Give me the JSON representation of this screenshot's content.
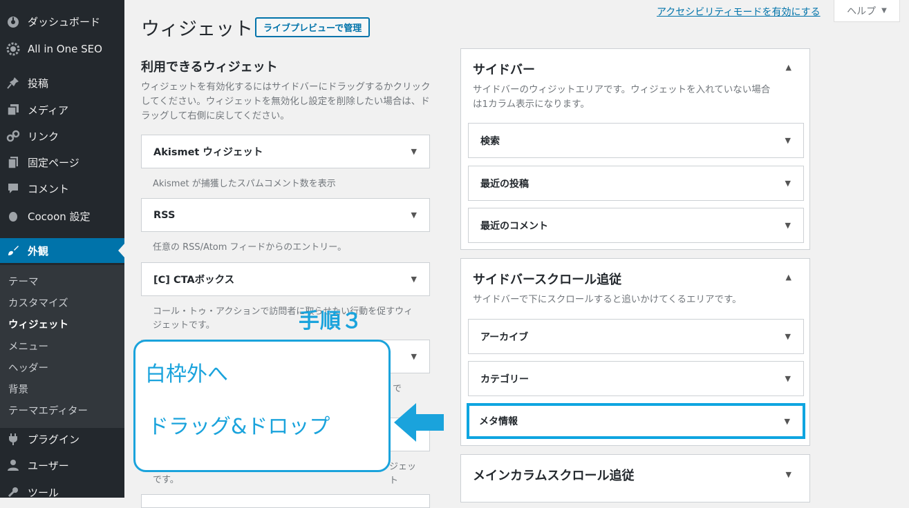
{
  "sidebar": {
    "items": [
      {
        "label": "ダッシュボード",
        "icon": "dashboard-icon"
      },
      {
        "label": "All in One SEO",
        "icon": "gear-icon"
      },
      {
        "label": "投稿",
        "icon": "pin-icon"
      },
      {
        "label": "メディア",
        "icon": "media-icon"
      },
      {
        "label": "リンク",
        "icon": "link-icon"
      },
      {
        "label": "固定ページ",
        "icon": "page-icon"
      },
      {
        "label": "コメント",
        "icon": "comment-icon"
      },
      {
        "label": "Cocoon 設定",
        "icon": "circle-icon"
      },
      {
        "label": "外観",
        "icon": "brush-icon"
      },
      {
        "label": "プラグイン",
        "icon": "plugin-icon"
      },
      {
        "label": "ユーザー",
        "icon": "user-icon"
      },
      {
        "label": "ツール",
        "icon": "wrench-icon"
      }
    ],
    "submenu": [
      "テーマ",
      "カスタマイズ",
      "ウィジェット",
      "メニュー",
      "ヘッダー",
      "背景",
      "テーマエディター"
    ]
  },
  "header": {
    "a11y_link": "アクセシビリティモードを有効にする",
    "help": "ヘルプ",
    "title": "ウィジェット",
    "live_preview": "ライブプレビューで管理"
  },
  "available": {
    "title": "利用できるウィジェット",
    "desc": "ウィジェットを有効化するにはサイドバーにドラッグするかクリックしてください。ウィジェットを無効化し設定を削除したい場合は、ドラッグして右側に戻してください。",
    "widgets": [
      {
        "name": "Akismet ウィジェット",
        "desc": "Akismet が捕獲したスパムコメント数を表示"
      },
      {
        "name": "RSS",
        "desc": "任意の RSS/Atom フィードからのエントリー。"
      },
      {
        "name": "[C] CTAボックス",
        "desc": "コール・トゥ・アクションで訪問者に取らせたい行動を促すウィジェットです。"
      },
      {
        "name": "",
        "desc": "で"
      },
      {
        "name": "",
        "desc": "ジェット"
      }
    ],
    "tail_desc": "です。"
  },
  "areas": [
    {
      "title": "サイドバー",
      "desc": "サイドバーのウィジットエリアです。ウィジェットを入れていない場合は1カラム表示になります。",
      "widgets": [
        "検索",
        "最近の投稿",
        "最近のコメント"
      ]
    },
    {
      "title": "サイドバースクロール追従",
      "desc": "サイドバーで下にスクロールすると追いかけてくるエリアです。",
      "widgets": [
        "アーカイブ",
        "カテゴリー",
        "メタ情報"
      ]
    },
    {
      "title": "メインカラムスクロール追従",
      "desc": "",
      "widgets": []
    }
  ],
  "annotation": {
    "step": "手順３",
    "line1": "白枠外へ",
    "line2": "ドラッグ&ドロップ"
  },
  "colors": {
    "admin_bar": "#23282d",
    "accent": "#0073aa",
    "annotation": "#1aa3dc"
  }
}
